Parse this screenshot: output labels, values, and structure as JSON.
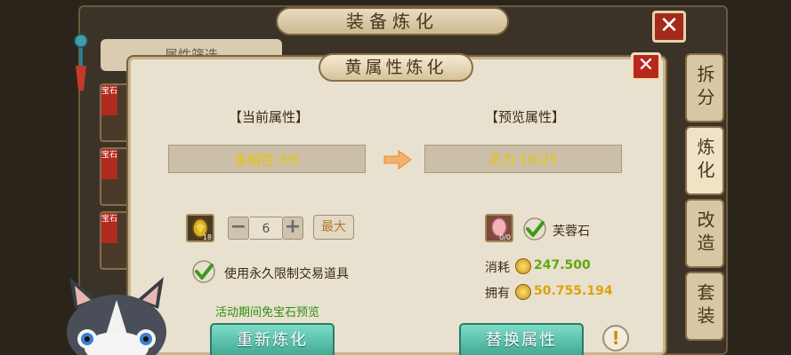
{
  "outer_window": {
    "title": "装备炼化",
    "close_label": "✕",
    "filter_tab": "属性筛选",
    "card_tags": [
      "宝石",
      "宝石",
      "宝石"
    ],
    "side_tabs": [
      "拆分",
      "炼化",
      "改造",
      "套装"
    ]
  },
  "dialog": {
    "title": "黄属性炼化",
    "close_label": "✕",
    "current_header": "【当前属性】",
    "preview_header": "【预览属性】",
    "current_attr": "金相性:3/5",
    "preview_attr": "灵力:10/25",
    "left_item_count": "18",
    "stepper_minus": "−",
    "stepper_value": "6",
    "stepper_plus": "+",
    "max_label": "最大",
    "use_limited_label": "使用永久限制交易道具",
    "stone_count": "0/0",
    "stone_label": "芙蓉石",
    "consume_label": "消耗",
    "consume_value": "247.500",
    "own_label": "拥有",
    "own_value": "50.755.194",
    "event_note": "活动期间免宝石预览",
    "reforge_button": "重新炼化",
    "replace_button": "替换属性",
    "help_label": "!"
  },
  "colors": {
    "attr_text": "#e8c500",
    "consume_green": "#62a80e",
    "own_gold": "#e0a10c",
    "event_green": "#2f8f14",
    "button_teal": "#3fa78f"
  }
}
